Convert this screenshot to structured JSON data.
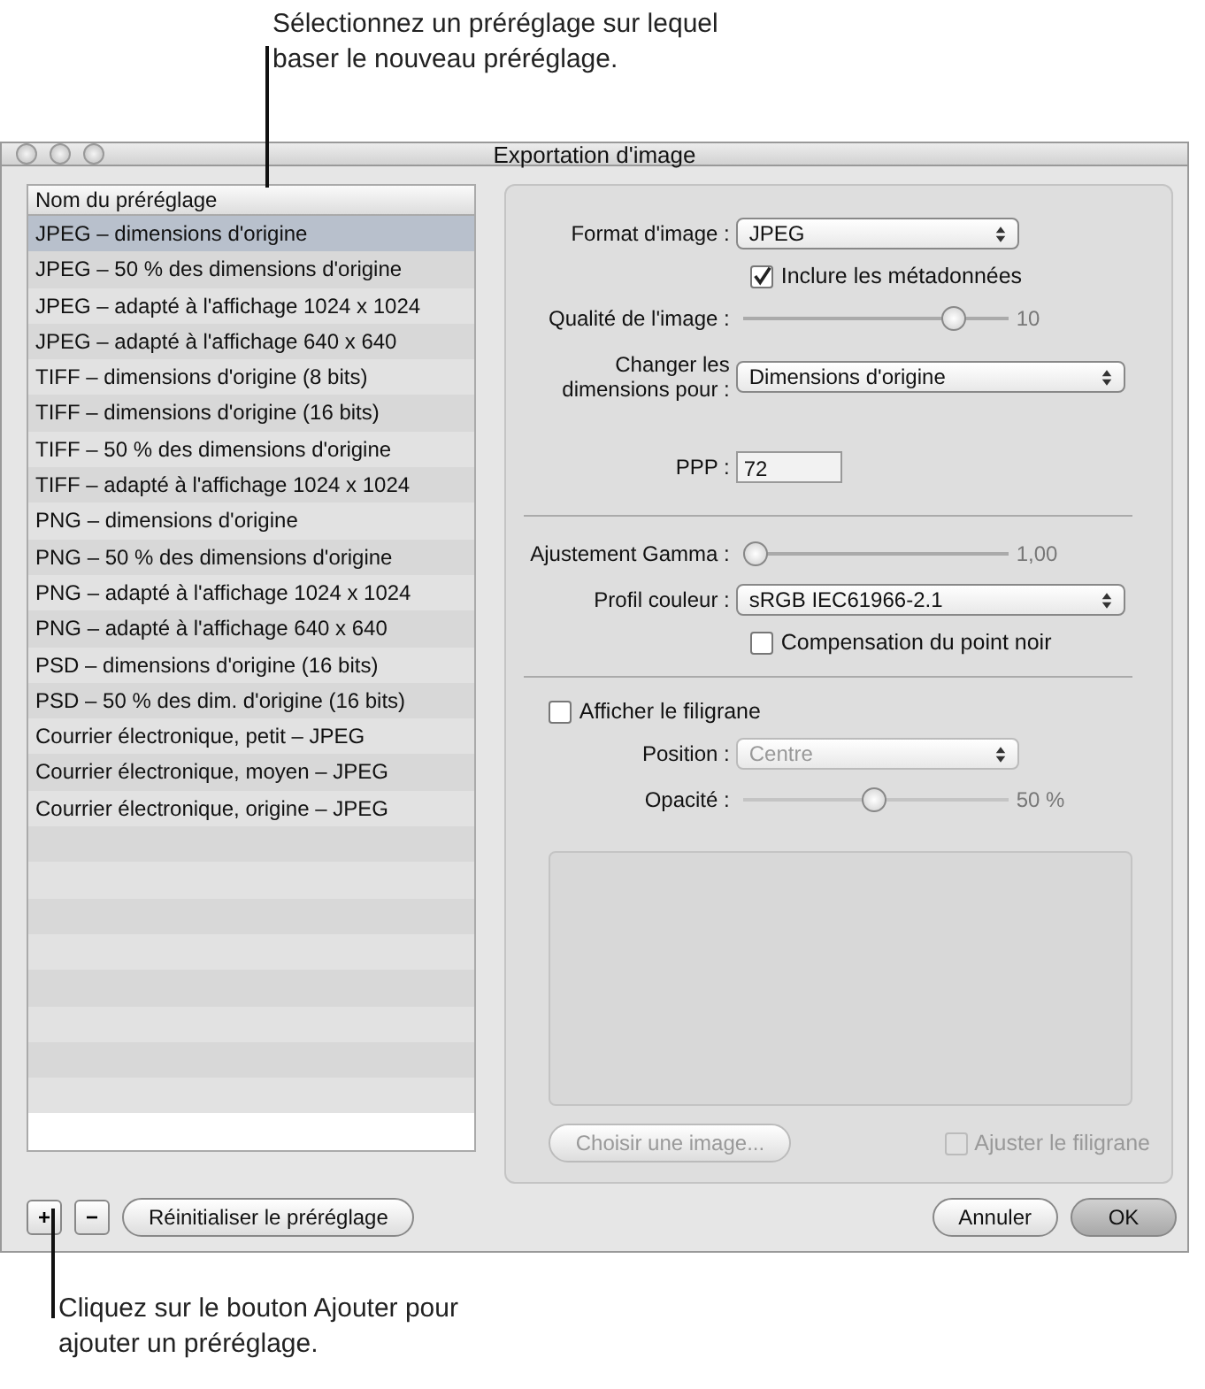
{
  "callouts": [
    {
      "text": "Sélectionnez un préréglage sur lequel baser le nouveau préréglage."
    },
    {
      "text": "Cliquez sur le bouton Ajouter pour ajouter un préréglage."
    }
  ],
  "window": {
    "title": "Exportation d'image"
  },
  "preset_list": {
    "header": "Nom du préréglage",
    "items": [
      {
        "label": "JPEG – dimensions d'origine",
        "selected": true
      },
      {
        "label": "JPEG – 50 % des dimensions d'origine",
        "selected": false
      },
      {
        "label": "JPEG – adapté à l'affichage 1024 x 1024",
        "selected": false
      },
      {
        "label": "JPEG – adapté à l'affichage 640 x 640",
        "selected": false
      },
      {
        "label": "TIFF – dimensions d'origine (8 bits)",
        "selected": false
      },
      {
        "label": "TIFF – dimensions d'origine (16 bits)",
        "selected": false
      },
      {
        "label": "TIFF – 50 % des dimensions d'origine",
        "selected": false
      },
      {
        "label": "TIFF – adapté à l'affichage 1024 x 1024",
        "selected": false
      },
      {
        "label": "PNG – dimensions d'origine",
        "selected": false
      },
      {
        "label": "PNG – 50 % des dimensions d'origine",
        "selected": false
      },
      {
        "label": "PNG – adapté à l'affichage 1024 x 1024",
        "selected": false
      },
      {
        "label": "PNG – adapté à l'affichage 640 x 640",
        "selected": false
      },
      {
        "label": "PSD – dimensions d'origine (16 bits)",
        "selected": false
      },
      {
        "label": "PSD – 50 % des dim. d'origine (16 bits)",
        "selected": false
      },
      {
        "label": "Courrier électronique, petit – JPEG",
        "selected": false
      },
      {
        "label": "Courrier électronique, moyen – JPEG",
        "selected": false
      },
      {
        "label": "Courrier électronique, origine – JPEG",
        "selected": false
      }
    ]
  },
  "settings": [
    {
      "kind": "select",
      "label": "Format d'image :",
      "value": "JPEG",
      "disabled": false,
      "wide": false
    },
    {
      "kind": "checkbox",
      "label": "Inclure les métadonnées",
      "checked": true,
      "disabled": false
    },
    {
      "kind": "slider",
      "label": "Qualité de l'image :",
      "level": 0.82,
      "reading": "10",
      "disabled": false
    },
    {
      "kind": "select",
      "label": "Changer les dimensions pour :",
      "value": "Dimensions d'origine",
      "disabled": false,
      "wide": true
    },
    {
      "kind": "field",
      "label": "PPP :",
      "value": "72"
    },
    {
      "kind": "divider"
    },
    {
      "kind": "slider",
      "label": "Ajustement Gamma :",
      "level": 0,
      "reading": "1,00",
      "disabled": false
    },
    {
      "kind": "select",
      "label": "Profil couleur :",
      "value": "sRGB IEC61966-2.1",
      "disabled": false,
      "wide": true
    },
    {
      "kind": "checkbox",
      "label": "Compensation du point noir",
      "checked": false,
      "disabled": false
    },
    {
      "kind": "divider"
    },
    {
      "kind": "toggle",
      "label": "Afficher le filigrane",
      "checked": false,
      "disabled": false
    },
    {
      "kind": "select",
      "label": "Position :",
      "value": "Centre",
      "disabled": true,
      "wide": false
    },
    {
      "kind": "slider",
      "label": "Opacité :",
      "level": 0.49,
      "reading": "50 %",
      "disabled": true
    }
  ],
  "watermark": {
    "choose_button": {
      "label": "Choisir une image...",
      "disabled": true
    },
    "fit": {
      "label": "Ajuster le filigrane",
      "checked": false,
      "disabled": true
    }
  },
  "footer": {
    "add": "+",
    "remove": "−",
    "reset": "Réinitialiser le préréglage",
    "cancel": "Annuler",
    "ok": "OK"
  }
}
